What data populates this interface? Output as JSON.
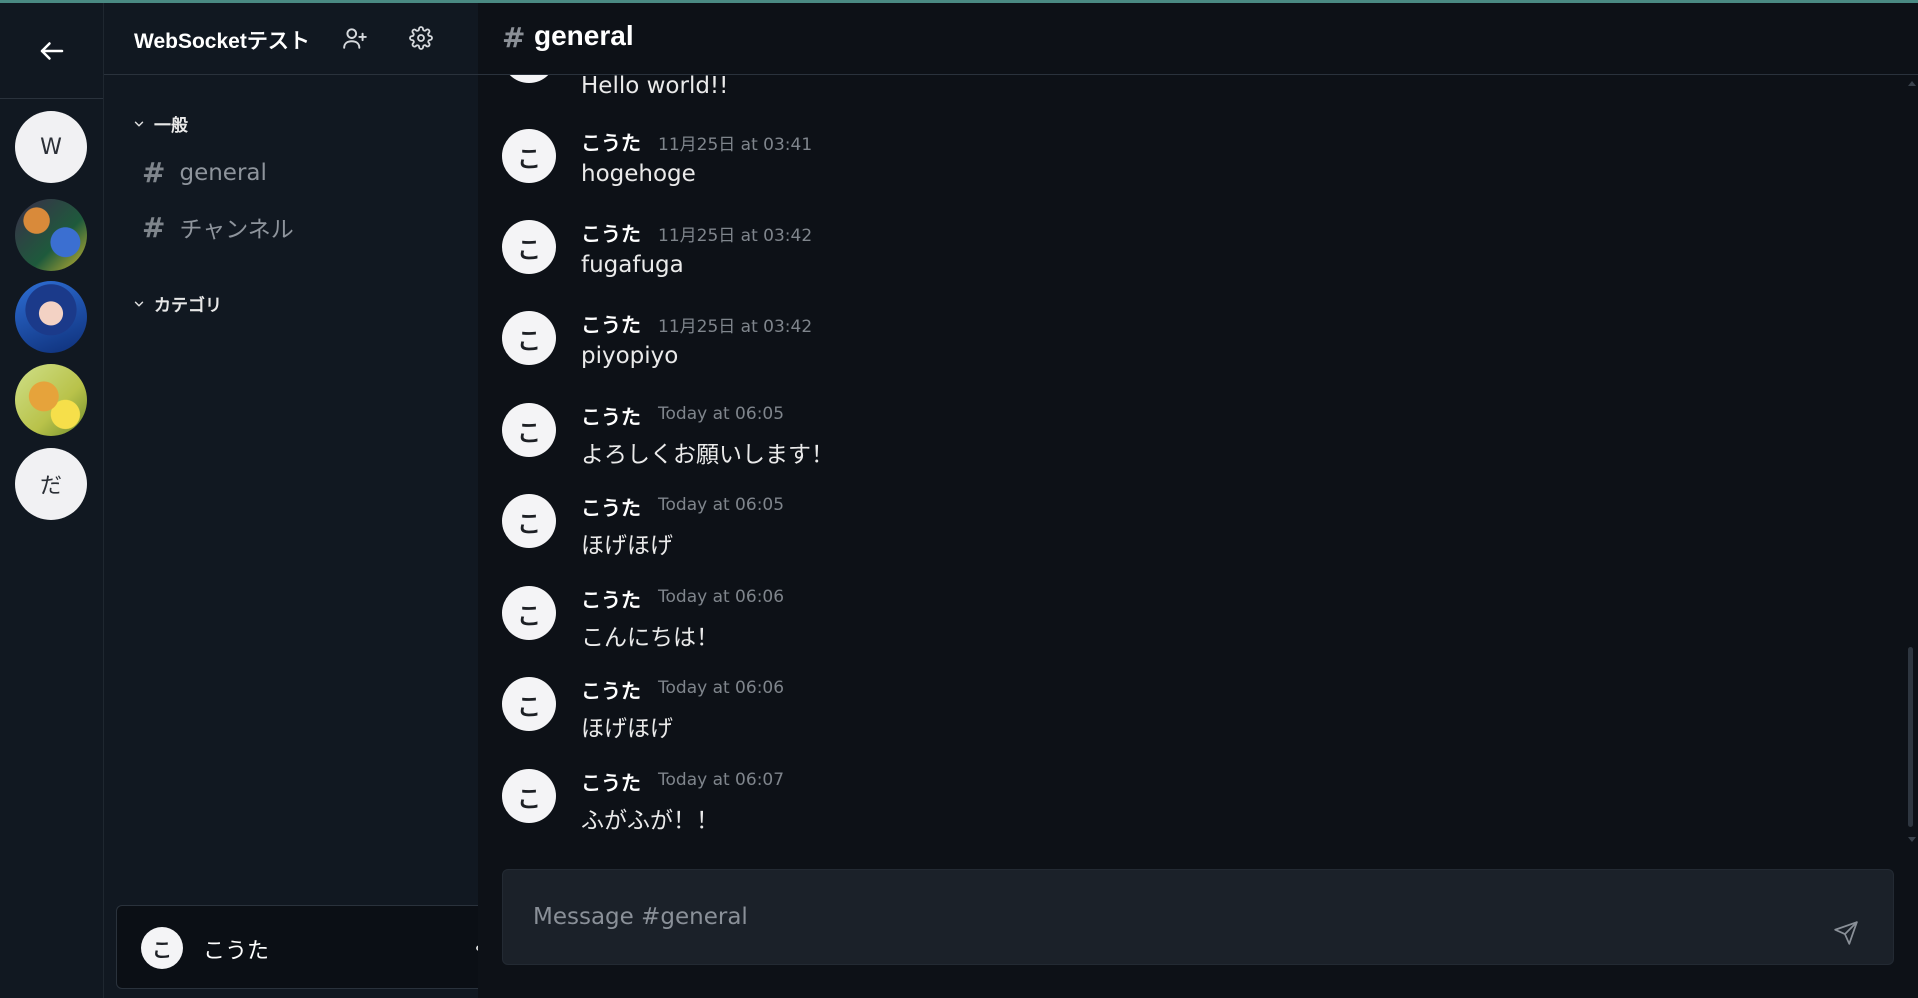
{
  "servers": [
    {
      "initial": "W"
    },
    {
      "initial": ""
    },
    {
      "initial": ""
    },
    {
      "initial": ""
    },
    {
      "initial": "だ"
    }
  ],
  "sidebar": {
    "server_name": "WebSocketテスト",
    "categories": [
      {
        "label": "一般",
        "channels": [
          "general",
          "チャンネル"
        ]
      },
      {
        "label": "カテゴリ",
        "channels": []
      }
    ]
  },
  "user": {
    "initial": "こ",
    "name": "こうた"
  },
  "channel": {
    "hash": "#",
    "title": "general"
  },
  "messages": [
    {
      "initial": "こ",
      "author": "",
      "time": "",
      "text": "Hello world!!"
    },
    {
      "initial": "こ",
      "author": "こうた",
      "time": "11月25日 at 03:41",
      "text": "hogehoge"
    },
    {
      "initial": "こ",
      "author": "こうた",
      "time": "11月25日 at 03:42",
      "text": "fugafuga"
    },
    {
      "initial": "こ",
      "author": "こうた",
      "time": "11月25日 at 03:42",
      "text": "piyopiyo"
    },
    {
      "initial": "こ",
      "author": "こうた",
      "time": "Today at 06:05",
      "text": "よろしくお願いします！"
    },
    {
      "initial": "こ",
      "author": "こうた",
      "time": "Today at 06:05",
      "text": "ほげほげ"
    },
    {
      "initial": "こ",
      "author": "こうた",
      "time": "Today at 06:06",
      "text": "こんにちは！"
    },
    {
      "initial": "こ",
      "author": "こうた",
      "time": "Today at 06:06",
      "text": "ほげほげ"
    },
    {
      "initial": "こ",
      "author": "こうた",
      "time": "Today at 06:07",
      "text": "ふがふが！！"
    }
  ],
  "composer": {
    "placeholder": "Message #general"
  },
  "colors": {
    "accent_line": "#4a8a83",
    "background": "#0d1117",
    "sidebar": "#111821"
  }
}
